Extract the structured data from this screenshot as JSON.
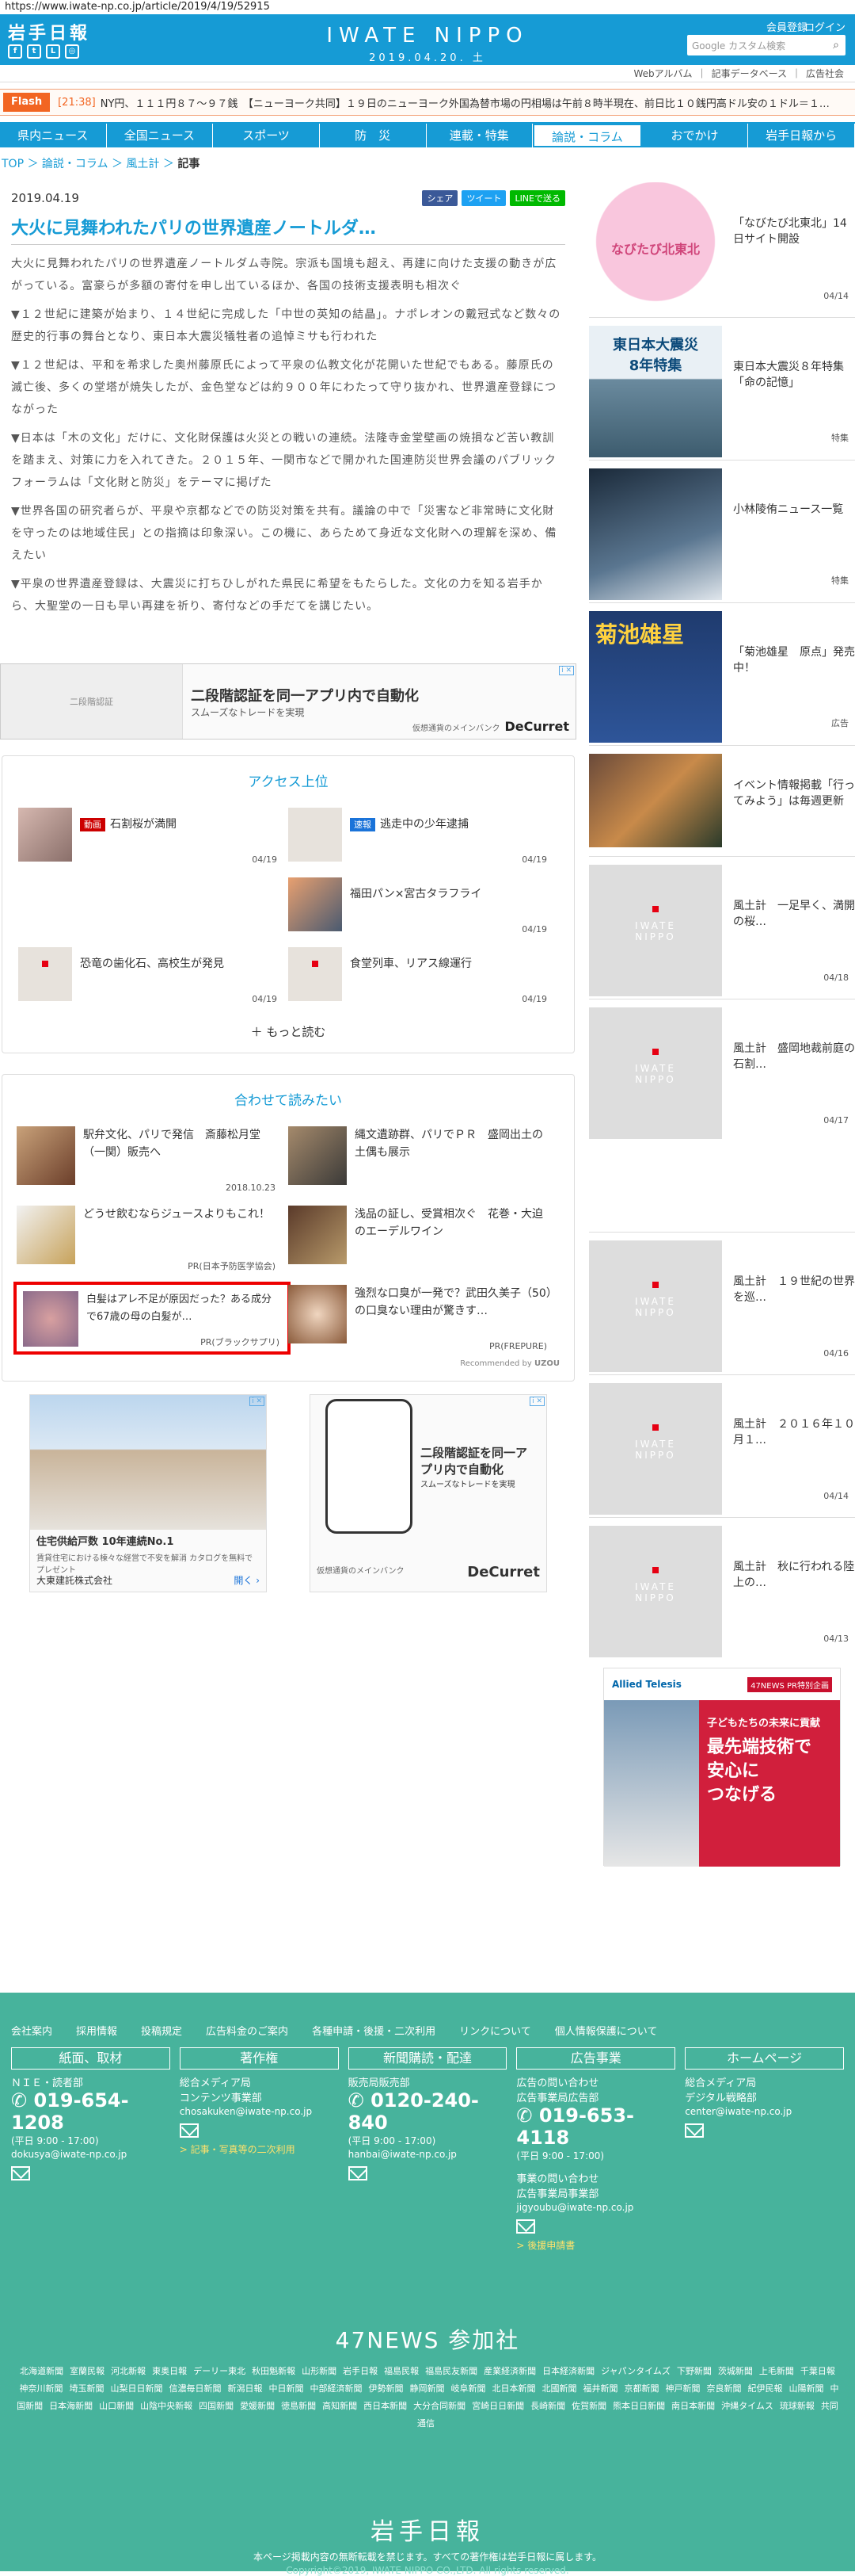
{
  "url": "https://www.iwate-np.co.jp/article/2019/4/19/52915",
  "header": {
    "logo": "岩手日報",
    "site_name": "IWATE NIPPO",
    "date": "2019.04.20. 土",
    "register": "会員登録",
    "login": "ログイン",
    "search_placeholder": "Google カスタム検索",
    "sublinks": [
      "Webアルバム",
      "｜",
      "記事データベース",
      "｜",
      "広告社会"
    ]
  },
  "flash": {
    "label": "Flash",
    "time": "[21:38]",
    "text": "NY円、１１１円８７～９７銭　【ニューヨーク共同】１９日のニューヨーク外国為替市場の円相場は午前８時半現在、前日比１０銭円高ドル安の１ドル＝１…"
  },
  "nav": [
    "県内ニュース",
    "全国ニュース",
    "スポーツ",
    "防　災",
    "連載・特集",
    "論説・コラム",
    "おでかけ",
    "岩手日報から"
  ],
  "breadcrumb": {
    "top": "TOP",
    "sep": "＞",
    "cat": "論説・コラム",
    "sub": "風土計",
    "current": "記事"
  },
  "article": {
    "date": "2019.04.19",
    "share": [
      "シェア",
      "ツイート",
      "LINEで送る"
    ],
    "title": "大火に見舞われたパリの世界遺産ノートルダ…",
    "paragraphs": [
      "大火に見舞われたパリの世界遺産ノートルダム寺院。宗派も国境も超え、再建に向けた支援の動きが広がっている。富豪らが多額の寄付を申し出ているほか、各国の技術支援表明も相次ぐ",
      "▼１２世紀に建築が始まり、１４世紀に完成した「中世の英知の結晶」。ナポレオンの戴冠式など数々の歴史的行事の舞台となり、東日本大震災犠牲者の追悼ミサも行われた",
      "▼１２世紀は、平和を希求した奥州藤原氏によって平泉の仏教文化が花開いた世紀でもある。藤原氏の滅亡後、多くの堂塔が焼失したが、金色堂などは約９００年にわたって守り抜かれ、世界遺産登録につながった",
      "▼日本は「木の文化」だけに、文化財保護は火災との戦いの連続。法隆寺金堂壁画の焼損など苦い教訓を踏まえ、対策に力を入れてきた。２０１５年、一関市などで開かれた国連防災世界会議のパブリックフォーラムは「文化財と防災」をテーマに掲げた",
      "▼世界各国の研究者らが、平泉や京都などでの防災対策を共有。議論の中で「災害など非常時に文化財を守ったのは地域住民」との指摘は印象深い。この機に、あらためて身近な文化財への理解を深め、備えたい",
      "▼平泉の世界遺産登録は、大震災に打ちひしがれた県民に希望をもたらした。文化の力を知る岩手から、大聖堂の一日も早い再建を祈り、寄付などの手だてを講じたい。"
    ]
  },
  "ad_wide": {
    "line1": "二段階認証を同一アプリ内で自動化",
    "line2": "スムーズなトレードを実現",
    "brand_sub": "仮想通貨のメインバンク",
    "brand": "DeCurret",
    "phone_caption": "二段階認証"
  },
  "access": {
    "title": "アクセス上位",
    "items": [
      {
        "badge": "動画",
        "text": "石割桜が満開",
        "date": "04/19"
      },
      {
        "badge": "速報",
        "text": "逃走中の少年逮捕",
        "date": "04/19"
      },
      {
        "badge": "",
        "text": "福田パン×宮古タラフライ",
        "date": "04/19"
      },
      {
        "badge": "",
        "text": "恐竜の歯化石、高校生が発見",
        "date": "04/19"
      },
      {
        "badge": "",
        "text": "食堂列車、リアス線運行",
        "date": "04/19"
      }
    ],
    "more": "もっと読む"
  },
  "related": {
    "title": "合わせて読みたい",
    "items": [
      {
        "text": "駅弁文化、パリで発信　斎藤松月堂（一関）販売へ",
        "sub": "2018.10.23"
      },
      {
        "text": "縄文遺跡群、パリでＰＲ　盛岡出土の土偶も展示",
        "sub": ""
      },
      {
        "text": "どうせ飲むならジュースよりもこれ！",
        "sub": "PR(日本予防医学協会)"
      },
      {
        "text": "浅品の証し、受賞相次ぐ　花巻・大迫のエーデルワイン",
        "sub": ""
      },
      {
        "text": "白髪はアレ不足が原因だった？ある成分で67歳の母の白髪が…",
        "sub": "PR(ブラックサプリ)"
      },
      {
        "text": "強烈な口臭が一発で？武田久美子（50）の口臭ない理由が驚きす…",
        "sub": "PR(FREPURE)"
      }
    ],
    "recommend": "Recommended by",
    "uzou": "UZOU"
  },
  "ads": {
    "left": {
      "caption": "住宅供給戸数 10年連続No.1",
      "sub": "賃貸住宅における棟々な経営で不安を解消 カタログを無料でプレゼント",
      "company": "大東建託株式会社",
      "go": "開く"
    },
    "right": {
      "line1": "二段階認証を同一アプリ内で自動化",
      "line2": "スムーズなトレードを実現",
      "brand_sub": "仮想通貨のメインバンク",
      "brand": "DeCurret"
    }
  },
  "sidebar": {
    "cards": [
      {
        "text": "「なびたび北東北」14日サイト開設",
        "date": "04/14",
        "img": "nabitabi"
      },
      {
        "text": "東日本大震災８年特集「命の記憶」",
        "date": "特集",
        "img": "quake"
      },
      {
        "text": "小林陵侑ニュース一覧",
        "date": "特集",
        "img": "ski"
      },
      {
        "text": "「菊池雄星　原点」発売中！",
        "date": "広告",
        "img": "kikuchi"
      },
      {
        "text": "イベント情報掲載「行ってみよう」は毎週更新",
        "date": "",
        "img": "event"
      },
      {
        "text": "風土計　一足早く、満開の桜…",
        "date": "04/18",
        "img": "logo"
      },
      {
        "text": "風土計　盛岡地裁前庭の石割…",
        "date": "04/17",
        "img": "logo"
      },
      {
        "text": "風土計　１９世紀の世界を巡…",
        "date": "04/16",
        "img": "logo"
      },
      {
        "text": "風土計　２０１６年１０月１…",
        "date": "04/14",
        "img": "logo"
      },
      {
        "text": "風土計　秋に行われる陸上の…",
        "date": "04/13",
        "img": "logo"
      }
    ],
    "placeholder_name": "IWATE\nNIPPO",
    "nabitabi_text": "なびたび北東北",
    "quake_text": "東日本大震災\n8年特集",
    "kikuchi_text": "菊池雄星",
    "ad": {
      "brand": "Allied Telesis",
      "tag": "47NEWS PR特別企画",
      "line1": "子どもたちの未来に貢献",
      "line2": "最先端技術で\n安心に\nつなげる"
    }
  },
  "footer": {
    "nav": [
      "会社案内",
      "採用情報",
      "投稿規定",
      "広告料金のご案内",
      "各種申請・後援・二次利用",
      "リンクについて",
      "個人情報保護について"
    ],
    "cols": [
      {
        "head": "紙面、取材",
        "l1": "ＮＩＥ・読者部",
        "phone": "019-654-1208",
        "hours": "(平日 9:00 - 17:00)",
        "mail": "dokusya@iwate-np.co.jp"
      },
      {
        "head": "著作権",
        "l1": "総合メディア局",
        "l2": "コンテンツ事業部",
        "mail": "chosakuken@iwate-np.co.jp",
        "link": "> 記事・写真等の二次利用"
      },
      {
        "head": "新聞購読・配達",
        "l1": "販売局販売部",
        "phone": "0120-240-840",
        "hours": "(平日 9:00 - 17:00)",
        "mail": "hanbai@iwate-np.co.jp"
      },
      {
        "head": "広告事業",
        "l1": "広告の問い合わせ",
        "l2": "広告事業局広告部",
        "phone": "019-653-4118",
        "hours": "(平日 9:00 - 17:00)",
        "l3": "事業の問い合わせ",
        "l4": "広告事業局事業部",
        "mail": "jigyoubu@iwate-np.co.jp",
        "link": "> 後援申請書"
      },
      {
        "head": "ホームページ",
        "l1": "総合メディア局",
        "l2": "デジタル戦略部",
        "mail": "center@iwate-np.co.jp"
      }
    ],
    "n47": "47NEWS 参加社",
    "papers": [
      "北海道新聞",
      "室蘭民報",
      "河北新報",
      "東奥日報",
      "デーリー東北",
      "秋田魁新報",
      "山形新聞",
      "岩手日報",
      "福島民報",
      "福島民友新聞",
      "産業経済新聞",
      "日本経済新聞",
      "ジャパンタイムズ",
      "下野新聞",
      "茨城新聞",
      "上毛新聞",
      "千葉日報",
      "神奈川新聞",
      "埼玉新聞",
      "山梨日日新聞",
      "信濃毎日新聞",
      "新潟日報",
      "中日新聞",
      "中部経済新聞",
      "伊勢新聞",
      "静岡新聞",
      "岐阜新聞",
      "北日本新聞",
      "北國新聞",
      "福井新聞",
      "京都新聞",
      "神戸新聞",
      "奈良新聞",
      "紀伊民報",
      "山陽新聞",
      "中国新聞",
      "日本海新聞",
      "山口新聞",
      "山陰中央新報",
      "四国新聞",
      "愛媛新聞",
      "徳島新聞",
      "高知新聞",
      "西日本新聞",
      "大分合同新聞",
      "宮崎日日新聞",
      "長崎新聞",
      "佐賀新聞",
      "熊本日日新聞",
      "南日本新聞",
      "沖縄タイムス",
      "琉球新報",
      "共同通信"
    ],
    "logo": "岩手日報",
    "copy1": "本ページ掲載内容の無断転載を禁じます。すべての著作権は岩手日報に属します。",
    "copy2": "Copyright©2019, IWATE NIPPO CO.,LTD. All rights reserved."
  },
  "colors": {
    "brand": "#169bd5",
    "flash": "#f26522",
    "footer": "#47b39c"
  }
}
